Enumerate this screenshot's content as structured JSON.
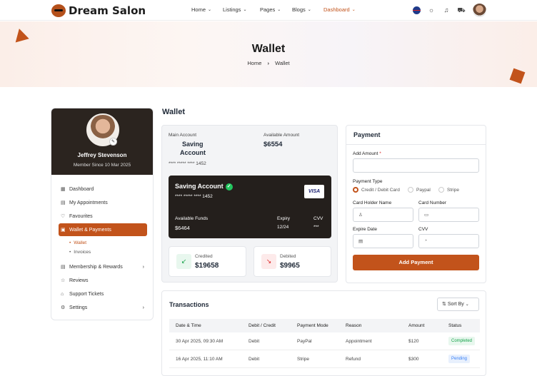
{
  "brand": {
    "name": "Dream Salon"
  },
  "nav": [
    {
      "label": "Home",
      "chevron": "chevron-down-icon"
    },
    {
      "label": "Listings",
      "chevron": "chevron-down-icon"
    },
    {
      "label": "Pages",
      "chevron": "chevron-down-icon"
    },
    {
      "label": "Blogs",
      "chevron": "chevron-down-icon"
    },
    {
      "label": "Dashboard",
      "chevron": "chevron-down-icon",
      "active": true
    }
  ],
  "header_icons": [
    "flag-uk-icon",
    "sun-icon",
    "bell-icon",
    "cart-icon",
    "user-avatar"
  ],
  "banner": {
    "title": "Wallet",
    "crumb_home": "Home",
    "crumb_sep": "›",
    "crumb_current": "Wallet"
  },
  "profile": {
    "name": "Jeffrey Stevenson",
    "since": "Member Since 10 Mar 2025"
  },
  "sidebar": {
    "items": [
      {
        "label": "Dashboard",
        "icon": "dashboard-icon"
      },
      {
        "label": "My Appointments",
        "icon": "calendar-icon"
      },
      {
        "label": "Favourites",
        "icon": "heart-icon"
      },
      {
        "label": "Wallet & Payments",
        "icon": "wallet-icon",
        "active": true
      },
      {
        "label": "Membership & Rewards",
        "icon": "membership-icon",
        "arrow": "›"
      },
      {
        "label": "Reviews",
        "icon": "star-icon"
      },
      {
        "label": "Support Tickets",
        "icon": "ticket-icon"
      },
      {
        "label": "Settings",
        "icon": "settings-icon",
        "arrow": "›"
      }
    ],
    "sub": [
      {
        "label": "Wallet",
        "active": true
      },
      {
        "label": "Invoices"
      }
    ]
  },
  "wallet": {
    "heading": "Wallet",
    "main_account_label": "Main Account",
    "main_account_line1": "Saving",
    "main_account_line2": "Account",
    "available_label": "Available Amount",
    "available_value": "$6554",
    "account_number": "**** ***** **** 1452",
    "card": {
      "title": "Saving Account",
      "number": "**** ***** **** 1452",
      "brand": "VISA",
      "funds_label": "Available Funds",
      "funds_value": "$6464",
      "expiry_label": "Expiry",
      "expiry_value": "12/24",
      "cvv_label": "CVV",
      "cvv_value": "***"
    },
    "credited_label": "Credited",
    "credited_value": "$19658",
    "debited_label": "Debited",
    "debited_value": "$9965"
  },
  "payment": {
    "title": "Payment",
    "amount_label": "Add Amount",
    "required_mark": "*",
    "type_label": "Payment Type",
    "types": [
      "Credit / Debit Card",
      "Paypal",
      "Stripe"
    ],
    "holder_label": "Card Holder Name",
    "number_label": "Card Number",
    "expire_label": "Expire Date",
    "cvv_label": "CVV",
    "button": "Add Payment"
  },
  "transactions": {
    "title": "Transactions",
    "sort_label": "Sort By",
    "columns": [
      "Date & Time",
      "Debit / Credit",
      "Payment Mode",
      "Reason",
      "Amount",
      "Status"
    ],
    "rows": [
      {
        "date": "30 Apr 2025, 09:30 AM",
        "type": "Debit",
        "mode": "PayPal",
        "reason": "Appointment",
        "amount": "$120",
        "status": "Completed",
        "status_color": "#16a34a"
      },
      {
        "date": "16 Apr 2025, 11:10 AM",
        "type": "Debit",
        "mode": "Stripe",
        "reason": "Refund",
        "amount": "$300",
        "status": "Pending",
        "status_color": "#3b82f6"
      }
    ]
  },
  "colors": {
    "accent": "#c2531b",
    "dark": "#241f1c"
  }
}
